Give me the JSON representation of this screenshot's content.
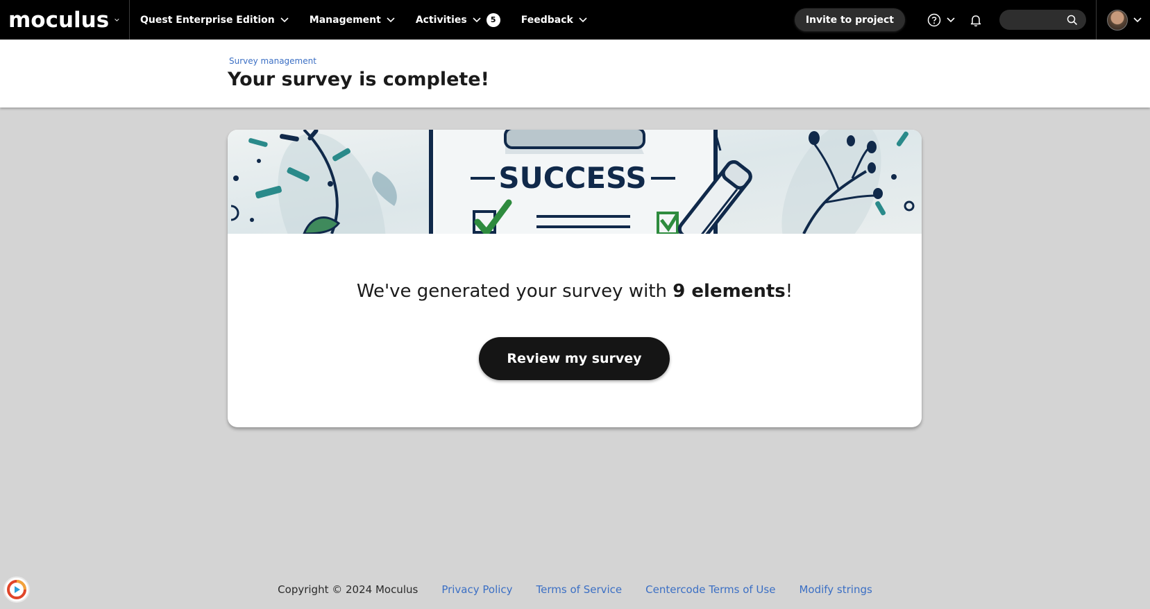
{
  "topnav": {
    "logo": "moculus",
    "project_menu": "Quest Enterprise Edition",
    "management_menu": "Management",
    "activities_menu": "Activities",
    "activities_badge": "5",
    "feedback_menu": "Feedback",
    "invite_button": "Invite to project",
    "icons": [
      "help-icon",
      "bell-icon",
      "search-icon",
      "avatar"
    ]
  },
  "header": {
    "breadcrumb": "Survey management",
    "title": "Your survey is complete!"
  },
  "card": {
    "banner_text": "SUCCESS",
    "message_prefix": "We've generated your survey with ",
    "message_count": "9 elements",
    "message_suffix": "!",
    "review_button": "Review my survey"
  },
  "footer": {
    "copyright": "Copyright © 2024 Moculus",
    "links": [
      "Privacy Policy",
      "Terms of Service",
      "Centercode Terms of Use",
      "Modify strings"
    ]
  },
  "colors": {
    "nav_bg": "#000000",
    "page_bg": "#d4d4d4",
    "link": "#3b6fc4",
    "button_dark": "#151515",
    "banner_teal": "#2a8a8a",
    "banner_navy": "#10294a",
    "check_green": "#2e8b3e"
  }
}
